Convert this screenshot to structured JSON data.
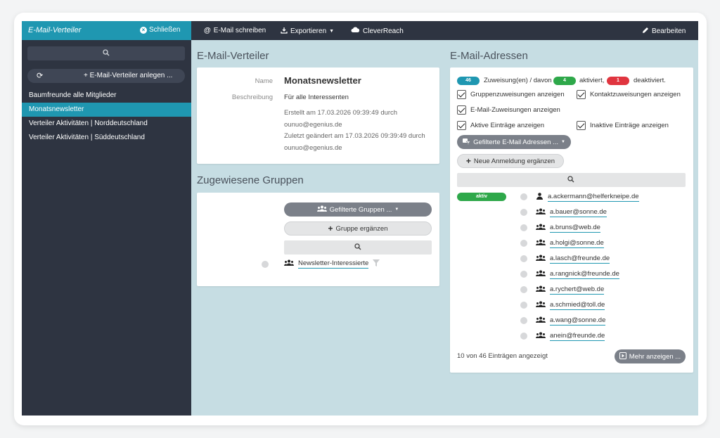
{
  "sidebar": {
    "title": "E-Mail-Verteiler",
    "close_label": "Schließen",
    "add_label": "E-Mail-Verteiler anlegen ...",
    "items": [
      {
        "label": "Baumfreunde alle Mitglieder",
        "active": false
      },
      {
        "label": "Monatsnewsletter",
        "active": true
      },
      {
        "label": "Verteiler Aktivitäten | Norddeutschland",
        "active": false
      },
      {
        "label": "Verteiler Aktivitäten | Süddeutschland",
        "active": false
      }
    ]
  },
  "topbar": {
    "write_label": "E-Mail schreiben",
    "export_label": "Exportieren",
    "cleverreach_label": "CleverReach",
    "edit_label": "Bearbeiten"
  },
  "details": {
    "section_title": "E-Mail-Verteiler",
    "name_label": "Name",
    "name_value": "Monatsnewsletter",
    "desc_label": "Beschreibung",
    "desc_value": "Für alle Interessenten",
    "created_line1": "Erstellt am 17.03.2026 09:39:49 durch",
    "created_line2": "ounuo@egenius.de",
    "changed_line1": "Zuletzt geändert am 17.03.2026 09:39:49 durch",
    "changed_line2": "ounuo@egenius.de"
  },
  "groups": {
    "section_title": "Zugewiesene Gruppen",
    "filter_label": "Gefilterte Gruppen ...",
    "add_label": "Gruppe ergänzen",
    "items": [
      {
        "label": "Newsletter-Interessierte"
      }
    ]
  },
  "addresses": {
    "section_title": "E-Mail-Adressen",
    "count_total": "46",
    "count_text": "Zuweisung(en) / davon",
    "count_active": "4",
    "active_text": "aktiviert,",
    "count_inactive": "1",
    "inactive_text": "deaktiviert.",
    "checkboxes": {
      "group_assign": "Gruppenzuweisungen anzeigen",
      "contact_assign": "Kontaktzuweisungen anzeigen",
      "email_assign": "E-Mail-Zuweisungen anzeigen",
      "active_entries": "Aktive Einträge anzeigen",
      "inactive_entries": "Inaktive Einträge anzeigen"
    },
    "filter_label": "Gefilterte E-Mail Adressen ...",
    "add_label": "Neue Anmeldung ergänzen",
    "status_badge": "aktiv",
    "items": [
      {
        "email": "a.ackermann@helferkneipe.de",
        "icon": "user-icon"
      },
      {
        "email": "a.bauer@sonne.de",
        "icon": "users-icon"
      },
      {
        "email": "a.bruns@web.de",
        "icon": "users-icon"
      },
      {
        "email": "a.holgi@sonne.de",
        "icon": "users-icon"
      },
      {
        "email": "a.lasch@freunde.de",
        "icon": "users-icon"
      },
      {
        "email": "a.rangnick@freunde.de",
        "icon": "users-icon"
      },
      {
        "email": "a.rychert@web.de",
        "icon": "users-icon"
      },
      {
        "email": "a.schmied@toll.de",
        "icon": "users-icon"
      },
      {
        "email": "a.wang@sonne.de",
        "icon": "users-icon"
      },
      {
        "email": "anein@freunde.de",
        "icon": "users-icon"
      }
    ],
    "footer_text": "10 von 46 Einträgen angezeigt",
    "more_label": "Mehr anzeigen ..."
  },
  "colors": {
    "accent": "#1f97b1",
    "dark": "#2e3441",
    "green": "#2ea84a",
    "red": "#e0353f"
  }
}
